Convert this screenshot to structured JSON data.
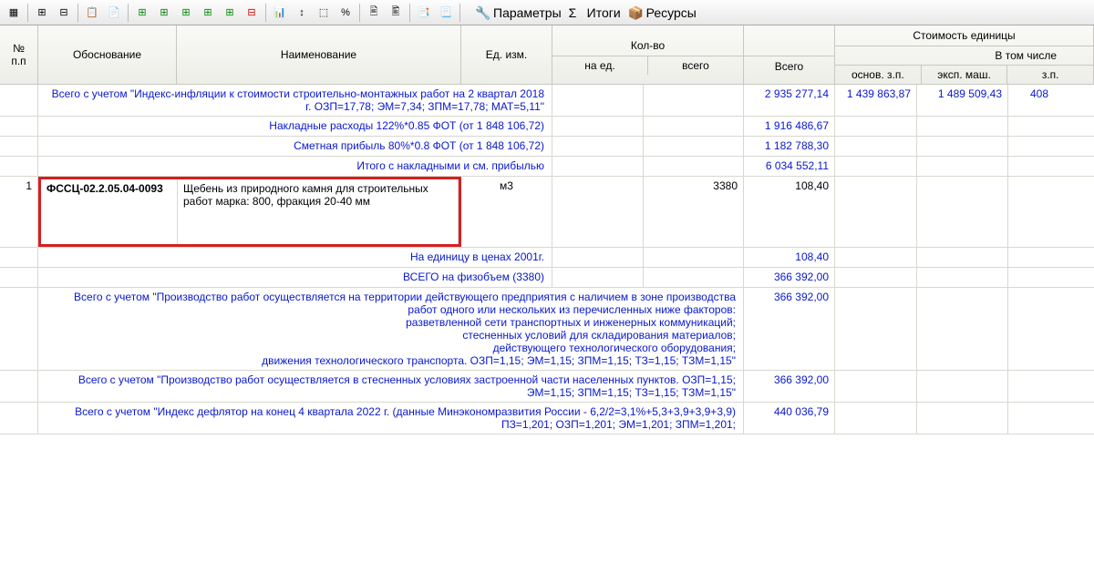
{
  "toolbar": {
    "panels": {
      "params": "Параметры",
      "totals": "Итоги",
      "resources": "Ресурсы"
    }
  },
  "headers": {
    "num": "№\nп.п",
    "basis": "Обоснование",
    "name": "Наименование",
    "unit": "Ед. изм.",
    "qty": "Кол-во",
    "qty_unit": "на ед.",
    "qty_total": "всего",
    "total": "Всего",
    "unit_cost": "Стоимость единицы",
    "incl": "В том числе",
    "osn": "основ. з.п.",
    "eksp": "эксп. маш.",
    "zp": "з.п."
  },
  "rows": [
    {
      "type": "calc",
      "text": "Всего с учетом \"Индекс-инфляции к стоимости строительно-монтажных работ на 2 квартал 2018 г. ОЗП=17,78; ЭМ=7,34; ЗПМ=17,78; МАТ=5,11\"",
      "total": "2 935 277,14",
      "osn": "1 439 863,87",
      "eksp": "1 489 509,43",
      "zp": "408"
    },
    {
      "type": "calc",
      "text": "Накладные расходы 122%*0.85 ФОТ (от 1 848 106,72)",
      "total": "1 916 486,67"
    },
    {
      "type": "calc",
      "text": "Сметная прибыль 80%*0.8 ФОТ (от 1 848 106,72)",
      "total": "1 182 788,30"
    },
    {
      "type": "calc",
      "text": "Итого с накладными и см. прибылью",
      "total": "6 034 552,11"
    },
    {
      "type": "item",
      "num": "1",
      "code": "ФССЦ-02.2.05.04-0093",
      "name": "Щебень из природного камня для строительных работ марка: 800, фракция 20-40 мм",
      "unit": "м3",
      "qty": "3380",
      "total": "108,40"
    },
    {
      "type": "calc",
      "text": "На единицу в ценах 2001г.",
      "total": "108,40"
    },
    {
      "type": "calc",
      "text": "ВСЕГО на физобъем (3380)",
      "total": "366 392,00"
    },
    {
      "type": "calc",
      "text": "Всего с учетом \"Производство работ осуществляется на территории действующего предприятия с наличием в зоне производства работ одного или нескольких из перечисленных ниже факторов:\nразветвленной сети транспортных и инженерных коммуникаций;\nстесненных условий для складирования материалов;\nдействующего технологического оборудования;\nдвижения технологического транспорта. ОЗП=1,15; ЭМ=1,15; ЗПМ=1,15; ТЗ=1,15; ТЗМ=1,15\"",
      "total": "366 392,00"
    },
    {
      "type": "calc",
      "text": "Всего с учетом \"Производство работ осуществляется в стесненных условиях застроенной части населенных пунктов. ОЗП=1,15; ЭМ=1,15; ЗПМ=1,15; ТЗ=1,15; ТЗМ=1,15\"",
      "total": "366 392,00"
    },
    {
      "type": "calc",
      "text": "Всего с учетом \"Индекс дефлятор на конец 4 квартала 2022 г. (данные Минэкономразвития России - 6,2/2=3,1%+5,3+3,9+3,9+3,9) ПЗ=1,201; ОЗП=1,201; ЭМ=1,201; ЗПМ=1,201;",
      "total": "440 036,79"
    }
  ]
}
